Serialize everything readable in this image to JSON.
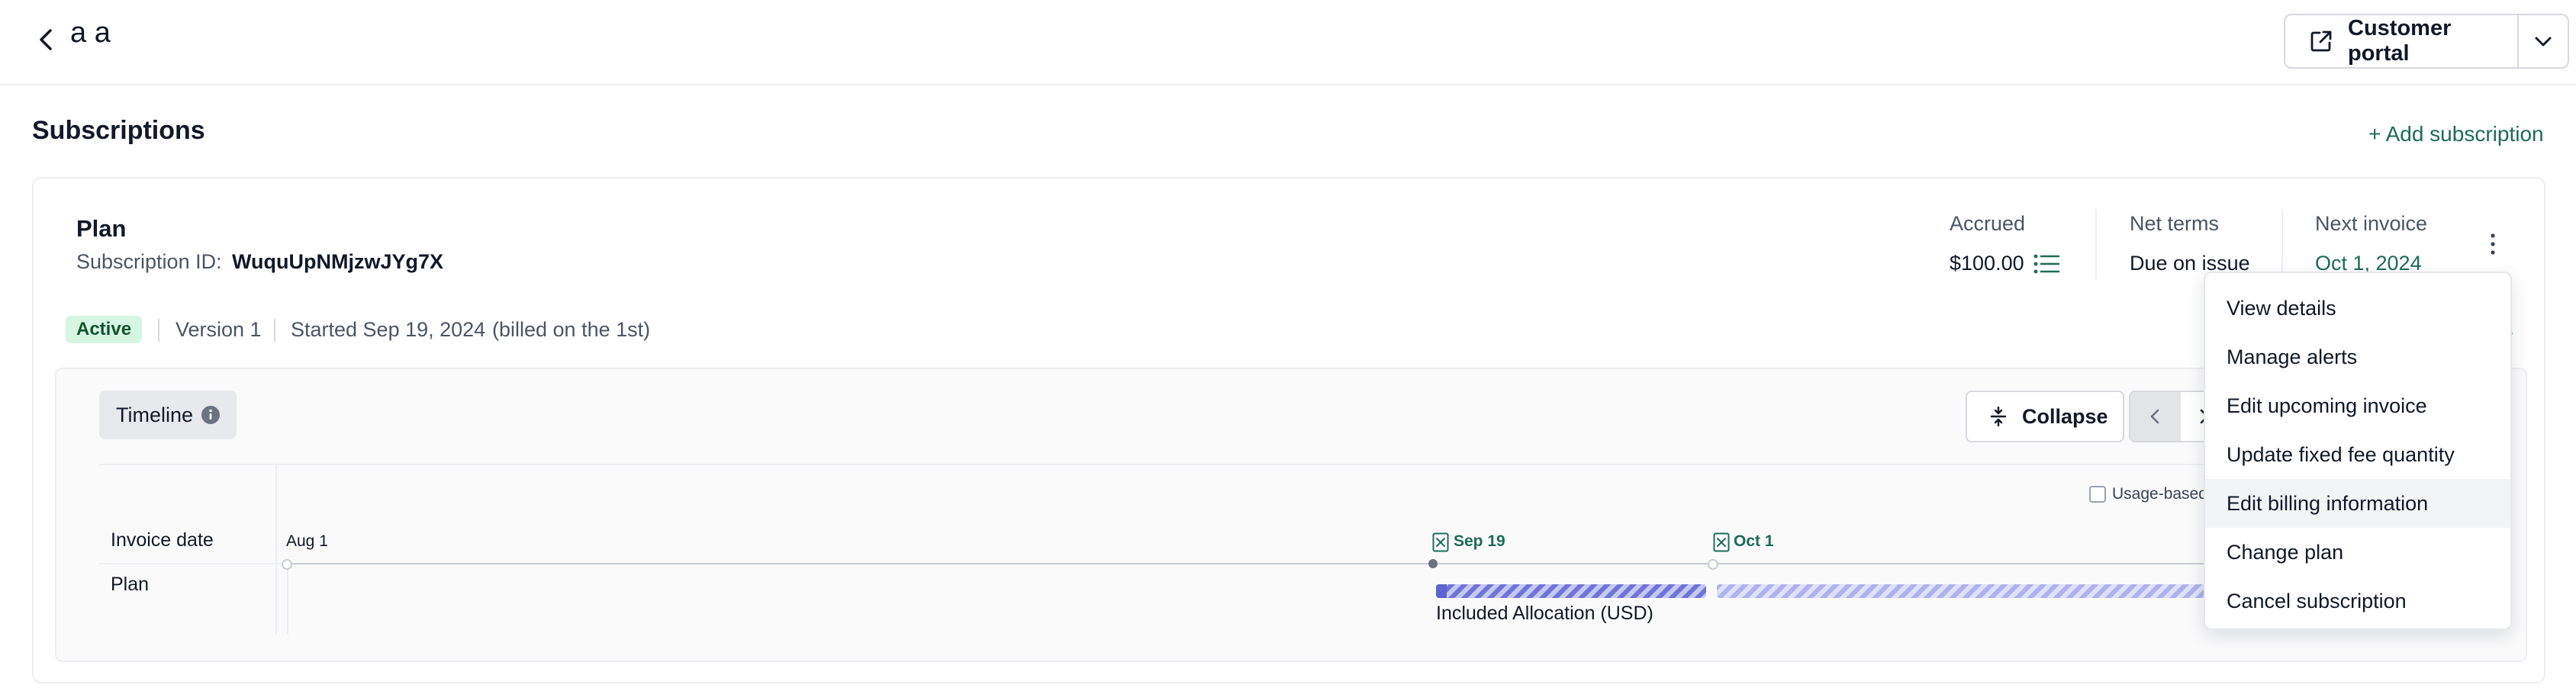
{
  "header": {
    "customer_name": "a a",
    "portal_label": "Customer portal"
  },
  "section": {
    "title": "Subscriptions",
    "add_label": "+ Add subscription"
  },
  "subscription": {
    "plan_title": "Plan",
    "id_label": "Subscription ID:",
    "id_value": "WuquUpNMjzwJYg7X",
    "status": "Active",
    "version": "Version 1",
    "started": "Started Sep 19, 2024",
    "billed": "(billed on the 1st)",
    "stats": {
      "accrued_label": "Accrued",
      "accrued_value": "$100.00",
      "net_terms_label": "Net terms",
      "net_terms_value": "Due on issue",
      "next_invoice_label": "Next invoice",
      "next_invoice_value": "Oct 1, 2024"
    },
    "peek_text": "s"
  },
  "timeline": {
    "tab_label": "Timeline",
    "collapse_label": "Collapse",
    "usage_toggle_label": "Usage-based",
    "rows": [
      "Invoice date",
      "Plan"
    ],
    "ticks": [
      "Aug 1",
      "Sep 19",
      "Oct 1"
    ],
    "bar_label": "Included Allocation (USD)"
  },
  "menu": {
    "items": [
      "View details",
      "Manage alerts",
      "Edit upcoming invoice",
      "Update fixed fee quantity",
      "Edit billing information",
      "Change plan",
      "Cancel subscription"
    ],
    "hovered_index": 4
  },
  "colors": {
    "accent": "#1d6b5a",
    "active_badge_bg": "#d6f5e3",
    "bar_primary": "#6f75d6",
    "bar_secondary": "#aeb2ec"
  },
  "icons": {
    "back": "chevron-left-icon",
    "portal": "external-link-icon",
    "portal_dropdown": "chevron-down-icon",
    "accrued_breakdown": "list-icon",
    "more": "kebab-icon",
    "info": "info-icon",
    "collapse": "collapse-icon",
    "prev": "chevron-left-icon",
    "next": "chevron-right-icon",
    "invoice_marker": "invoice-icon"
  }
}
